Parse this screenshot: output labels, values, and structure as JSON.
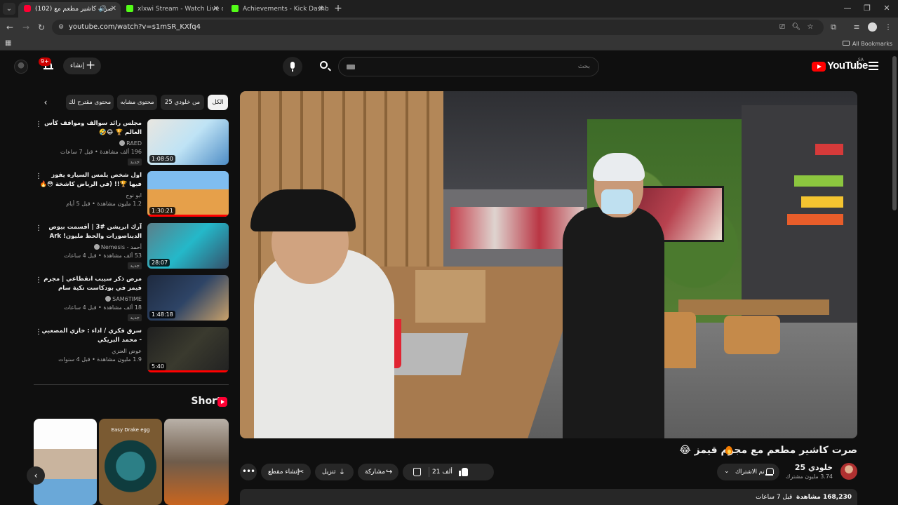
{
  "browser": {
    "tabs": [
      {
        "title": "(102) صرت كاشير مطعم مع",
        "favicon": "youtube-icon",
        "active": true
      },
      {
        "title": "xlxwi Stream - Watch Live on Kick",
        "favicon": "kick-icon",
        "active": false
      },
      {
        "title": "Achievements - Kick Dashboard",
        "favicon": "kick-icon",
        "active": false
      }
    ],
    "url": "youtube.com/watch?v=s1mSR_KXfq4",
    "bookmarks_label": "All Bookmarks"
  },
  "youtube": {
    "logo_text": "YouTube",
    "region": "SA",
    "search_placeholder": "بحث",
    "create_label": "إنشاء",
    "notifications_badge": "9+"
  },
  "video": {
    "title": "صرت كاشير مطعم مع مجرم قيمز 😂",
    "channel_name": "خلودي 25",
    "subscribers": "3.74 مليون مشترك",
    "subscribe_label": "تم الاشتراك",
    "likes": "21 ألف",
    "share_label": "مشاركة",
    "download_label": "تنزيل",
    "clip_label": "إنشاء مقطع",
    "views": "168,230 مشاهدة",
    "posted": "قبل 7 ساعات"
  },
  "chips": [
    {
      "label": "الكل",
      "active": true
    },
    {
      "label": "من خلودي 25",
      "active": false
    },
    {
      "label": "محتوى مشابه",
      "active": false
    },
    {
      "label": "محتوى مقترح لك",
      "active": false
    }
  ],
  "recommendations": [
    {
      "title": "مجلس رائد  سوالف ومواقف كأس العالم 🏆 😂🤣",
      "channel": "RAED",
      "verified": true,
      "stats": "196 ألف مشاهدة • قبل 7 ساعات",
      "badge": "جديد",
      "duration": "1:08:50"
    },
    {
      "title": "اول شخص يلمس السياره يفوز فيها 🏆!! (في الرياض كاشخة 😳🔥 !! )",
      "channel": "ابو نوح",
      "verified": false,
      "stats": "1.2 مليون مشاهدة • قبل 5 أيام",
      "badge": "",
      "duration": "1:30:21"
    },
    {
      "title": "آرك ابريشن #3 | أقسمت بيوض الديناصورات والحظ مليون! Ark Survival ...",
      "channel": "أحمد - Nemesis",
      "verified": true,
      "stats": "53 ألف مشاهدة • قبل 4 ساعات",
      "badge": "جديد",
      "duration": "28:07"
    },
    {
      "title": "مرض ذكر سيبب انقطاعي | مجرم قيمز في بودكاست تكية سام",
      "channel": "SAM6TIME",
      "verified": true,
      "stats": "18 ألف مشاهدة • قبل 4 ساعات",
      "badge": "جديد",
      "duration": "1:48:18"
    },
    {
      "title": "سرق فكري / اداء : خازي المصعبي - محمد البريكي",
      "channel": "عوض العنزي",
      "verified": false,
      "stats": "1.9 مليون مشاهدة • قبل 4 سنوات",
      "badge": "",
      "duration": "5:40"
    }
  ],
  "shorts": {
    "header": "Shorts",
    "items": [
      {
        "overlay": ""
      },
      {
        "overlay": "Easy Drake egg"
      },
      {
        "overlay": ""
      }
    ]
  }
}
